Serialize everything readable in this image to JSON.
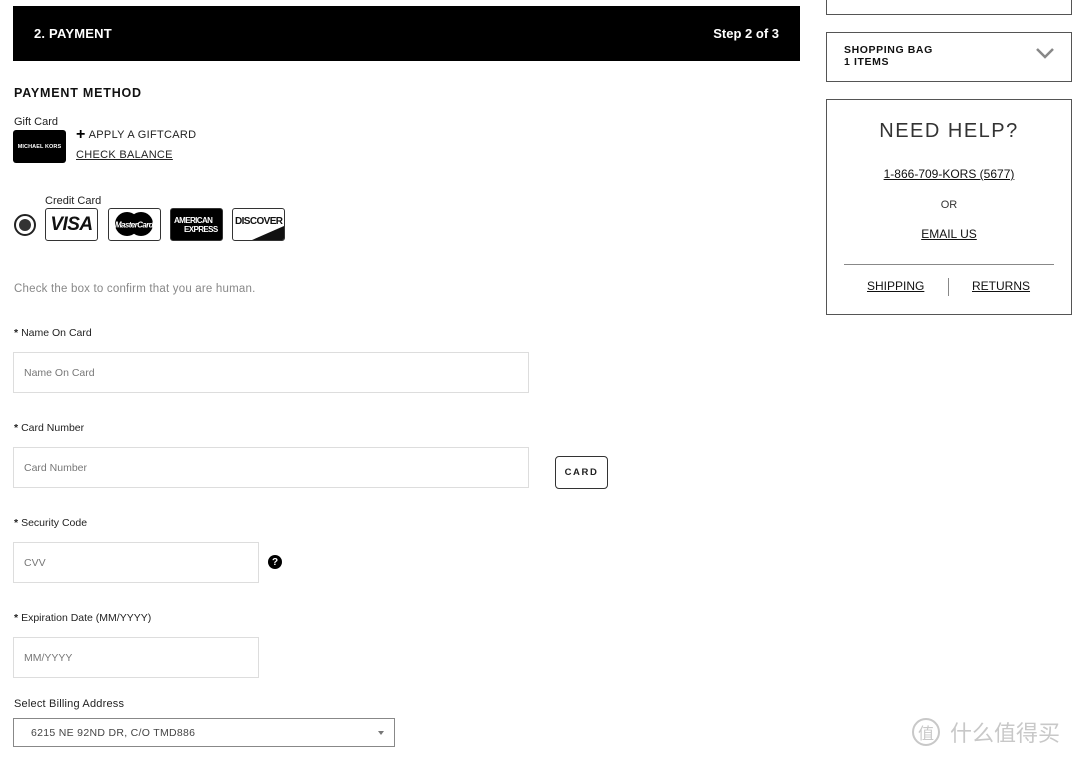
{
  "header": {
    "title": "2. PAYMENT",
    "step": "Step 2 of 3"
  },
  "payment": {
    "section_title": "PAYMENT METHOD",
    "gift_card": {
      "label": "Gift Card",
      "card_brand_text": "MICHAEL KORS",
      "apply_icon": "plus-icon",
      "apply_label": "APPLY A GIFTCARD",
      "check_balance_label": "CHECK BALANCE"
    },
    "credit_card": {
      "label": "Credit Card",
      "selected": true,
      "logos": {
        "visa": "VISA",
        "mastercard": "MasterCard",
        "amex_line1": "AMERICAN",
        "amex_line2": "EXPRESS",
        "discover": "DISCOVER"
      }
    },
    "captcha_text": "Check the box to confirm that you are human."
  },
  "form": {
    "name": {
      "required_mark": "*",
      "label": "Name On Card",
      "placeholder": "Name On Card",
      "value": ""
    },
    "card_number": {
      "required_mark": "*",
      "label": "Card Number",
      "placeholder": "Card Number",
      "value": "",
      "scan_button": "CARD"
    },
    "security_code": {
      "required_mark": "*",
      "label": "Security Code",
      "placeholder": "CVV",
      "value": "",
      "help_icon": "?"
    },
    "expiration": {
      "required_mark": "*",
      "label": "Expiration Date (MM/YYYY)",
      "placeholder": "MM/YYYY",
      "value": ""
    },
    "billing": {
      "label": "Select Billing Address",
      "selected": "6215 NE 92ND DR, C/O TMD886"
    }
  },
  "sidebar": {
    "bag": {
      "title": "SHOPPING BAG",
      "count": "1 ITEMS",
      "icon": "chevron-down-icon"
    },
    "help": {
      "title": "NEED HELP?",
      "phone": "1-866-709-KORS (5677)",
      "or": "OR",
      "email": "EMAIL US",
      "shipping": "SHIPPING",
      "returns": "RETURNS"
    }
  },
  "watermark": {
    "circle_char": "值",
    "text": "什么值得买"
  }
}
